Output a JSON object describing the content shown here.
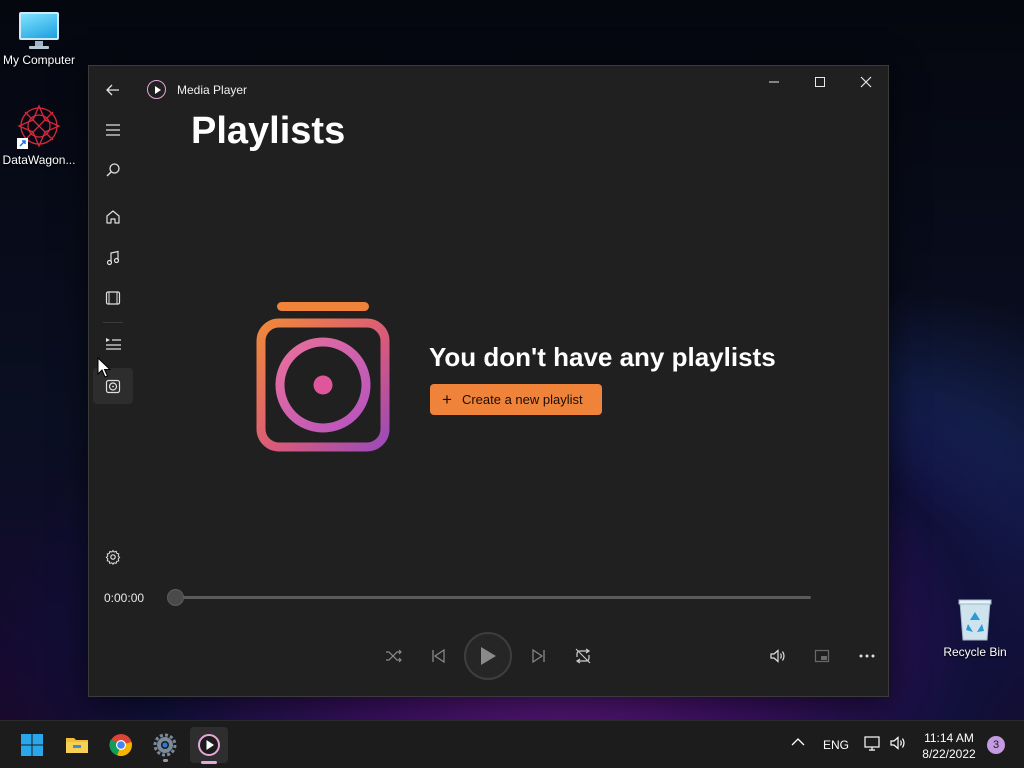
{
  "desktop": {
    "icons": [
      {
        "label": "My Computer"
      },
      {
        "label": "DataWagon..."
      },
      {
        "label": "Recycle Bin"
      }
    ]
  },
  "window": {
    "title": "Media Player",
    "controls": {
      "minimize": "minimize-icon",
      "maximize": "maximize-icon",
      "close": "close-icon"
    }
  },
  "sidebar": {
    "items": [
      {
        "name": "back",
        "icon": "back-arrow-icon"
      },
      {
        "name": "menu",
        "icon": "hamburger-icon"
      },
      {
        "name": "search",
        "icon": "search-icon"
      },
      {
        "name": "home",
        "icon": "home-icon"
      },
      {
        "name": "music",
        "icon": "music-note-icon"
      },
      {
        "name": "video",
        "icon": "film-icon"
      },
      {
        "name": "play-queue",
        "icon": "queue-icon"
      },
      {
        "name": "playlists",
        "icon": "playlist-icon",
        "active": true
      },
      {
        "name": "settings",
        "icon": "gear-icon"
      }
    ],
    "accent": "#f0833a"
  },
  "page": {
    "title": "Playlists",
    "empty_message": "You don't have any playlists",
    "create_button": {
      "icon": "+",
      "label": "Create a new playlist"
    }
  },
  "player": {
    "position": "0:00:00",
    "progress": 0,
    "controls": [
      "shuffle",
      "previous",
      "play",
      "next",
      "repeat",
      "volume",
      "mini-player",
      "more"
    ]
  },
  "taskbar": {
    "apps": [
      "start",
      "file-explorer",
      "chrome",
      "settings",
      "media-player"
    ],
    "tray": {
      "language": "ENG",
      "time": "11:14 AM",
      "date": "8/22/2022",
      "notification_count": "3"
    }
  },
  "colors": {
    "accent": "#f0833a",
    "window_bg": "#202020",
    "taskbar_bg": "#1c1c1c"
  }
}
